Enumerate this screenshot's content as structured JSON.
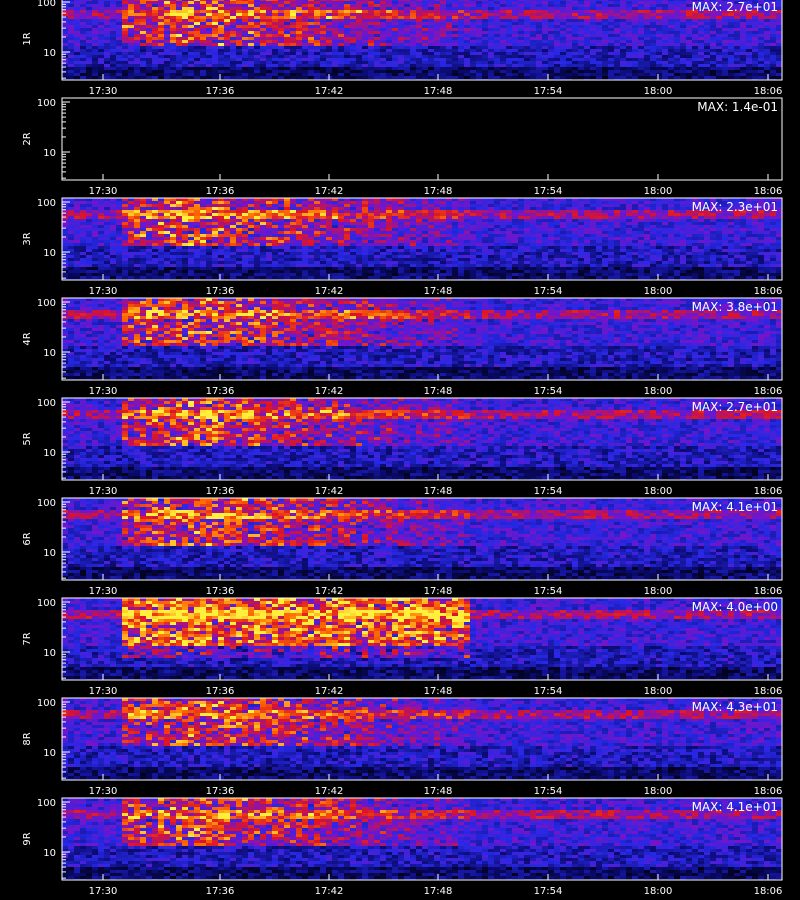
{
  "chart_data": [
    {
      "type": "heatmap",
      "panel_label": "1R",
      "max_label": "MAX: 2.7e+01",
      "max_value": 27.0,
      "x_ticks": [
        "17:30",
        "17:36",
        "17:42",
        "17:48",
        "17:54",
        "18:00",
        "18:06"
      ],
      "y_ticks": [
        "100",
        "10"
      ],
      "y_scale": "log",
      "colorscale": "black-blue-red-yellow"
    },
    {
      "type": "heatmap",
      "panel_label": "2R",
      "max_label": "MAX: 1.4e-01",
      "max_value": 0.14,
      "x_ticks": [
        "17:30",
        "17:36",
        "17:42",
        "17:48",
        "17:54",
        "18:00",
        "18:06"
      ],
      "y_ticks": [
        "100",
        "10"
      ],
      "y_scale": "log",
      "colorscale": "black-blue-red-yellow"
    },
    {
      "type": "heatmap",
      "panel_label": "3R",
      "max_label": "MAX: 2.3e+01",
      "max_value": 23.0,
      "x_ticks": [
        "17:30",
        "17:36",
        "17:42",
        "17:48",
        "17:54",
        "18:00",
        "18:06"
      ],
      "y_ticks": [
        "100",
        "10"
      ],
      "y_scale": "log",
      "colorscale": "black-blue-red-yellow"
    },
    {
      "type": "heatmap",
      "panel_label": "4R",
      "max_label": "MAX: 3.8e+01",
      "max_value": 38.0,
      "x_ticks": [
        "17:30",
        "17:36",
        "17:42",
        "17:48",
        "17:54",
        "18:00",
        "18:06"
      ],
      "y_ticks": [
        "100",
        "10"
      ],
      "y_scale": "log",
      "colorscale": "black-blue-red-yellow"
    },
    {
      "type": "heatmap",
      "panel_label": "5R",
      "max_label": "MAX: 2.7e+01",
      "max_value": 27.0,
      "x_ticks": [
        "17:30",
        "17:36",
        "17:42",
        "17:48",
        "17:54",
        "18:00",
        "18:06"
      ],
      "y_ticks": [
        "100",
        "10"
      ],
      "y_scale": "log",
      "colorscale": "black-blue-red-yellow"
    },
    {
      "type": "heatmap",
      "panel_label": "6R",
      "max_label": "MAX: 4.1e+01",
      "max_value": 41.0,
      "x_ticks": [
        "17:30",
        "17:36",
        "17:42",
        "17:48",
        "17:54",
        "18:00",
        "18:06"
      ],
      "y_ticks": [
        "100",
        "10"
      ],
      "y_scale": "log",
      "colorscale": "black-blue-red-yellow"
    },
    {
      "type": "heatmap",
      "panel_label": "7R",
      "max_label": "MAX: 4.0e+00",
      "max_value": 4.0,
      "x_ticks": [
        "17:30",
        "17:36",
        "17:42",
        "17:48",
        "17:54",
        "18:00",
        "18:06"
      ],
      "y_ticks": [
        "100",
        "10"
      ],
      "y_scale": "log",
      "colorscale": "black-blue-red-yellow"
    },
    {
      "type": "heatmap",
      "panel_label": "8R",
      "max_label": "MAX: 4.3e+01",
      "max_value": 43.0,
      "x_ticks": [
        "17:30",
        "17:36",
        "17:42",
        "17:48",
        "17:54",
        "18:00",
        "18:06"
      ],
      "y_ticks": [
        "100",
        "10"
      ],
      "y_scale": "log",
      "colorscale": "black-blue-red-yellow"
    },
    {
      "type": "heatmap",
      "panel_label": "9R",
      "max_label": "MAX: 4.1e+01",
      "max_value": 41.0,
      "x_ticks": [
        "17:30",
        "17:36",
        "17:42",
        "17:48",
        "17:54",
        "18:00",
        "18:06"
      ],
      "y_ticks": [
        "100",
        "10"
      ],
      "y_scale": "log",
      "colorscale": "black-blue-red-yellow"
    }
  ]
}
